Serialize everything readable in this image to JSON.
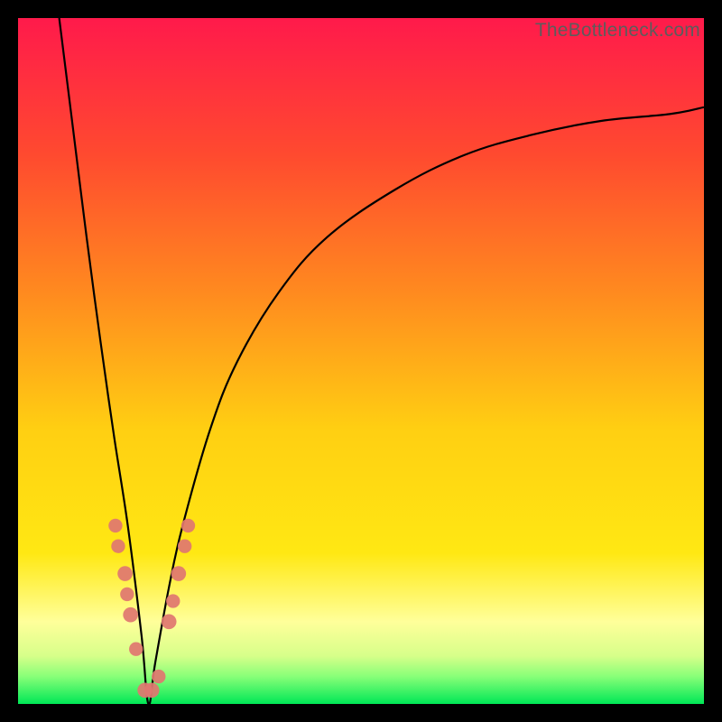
{
  "watermark": "TheBottleneck.com",
  "colors": {
    "red": "#ff1a4b",
    "orange": "#ff8a1f",
    "yellow": "#ffe813",
    "pale_yellow": "#ffff9a",
    "green_light": "#66ff6a",
    "green": "#00e756",
    "black": "#000000",
    "dot": "#e07770"
  },
  "chart_data": {
    "type": "line",
    "title": "",
    "xlabel": "",
    "ylabel": "",
    "xlim": [
      0,
      100
    ],
    "ylim": [
      0,
      100
    ],
    "note": "V-shaped bottleneck curve. Minimum near x≈19, y≈0. Left branch rises to y≈100 at x≈6; right branch rises to y≈87 at x=100. Pink dot-clusters sit along the lower V walls roughly at y between 12 and 25.",
    "series": [
      {
        "name": "bottleneck-curve",
        "x": [
          6,
          8,
          10,
          12,
          14,
          16,
          18,
          19,
          20,
          22,
          24,
          28,
          32,
          38,
          45,
          55,
          65,
          75,
          85,
          95,
          100
        ],
        "y": [
          100,
          84,
          68,
          53,
          39,
          26,
          10,
          0,
          6,
          17,
          26,
          40,
          50,
          60,
          68,
          75,
          80,
          83,
          85,
          86,
          87
        ]
      }
    ],
    "dots": [
      {
        "x": 14.2,
        "y": 26,
        "r": 2.4
      },
      {
        "x": 14.6,
        "y": 23,
        "r": 2.4
      },
      {
        "x": 15.6,
        "y": 19,
        "r": 2.6
      },
      {
        "x": 15.9,
        "y": 16,
        "r": 2.4
      },
      {
        "x": 16.4,
        "y": 13,
        "r": 2.6
      },
      {
        "x": 17.2,
        "y": 8,
        "r": 2.4
      },
      {
        "x": 18.5,
        "y": 2,
        "r": 2.6
      },
      {
        "x": 19.5,
        "y": 2,
        "r": 2.6
      },
      {
        "x": 20.5,
        "y": 4,
        "r": 2.4
      },
      {
        "x": 22.0,
        "y": 12,
        "r": 2.6
      },
      {
        "x": 22.6,
        "y": 15,
        "r": 2.4
      },
      {
        "x": 23.4,
        "y": 19,
        "r": 2.6
      },
      {
        "x": 24.3,
        "y": 23,
        "r": 2.4
      },
      {
        "x": 24.8,
        "y": 26,
        "r": 2.4
      }
    ]
  }
}
